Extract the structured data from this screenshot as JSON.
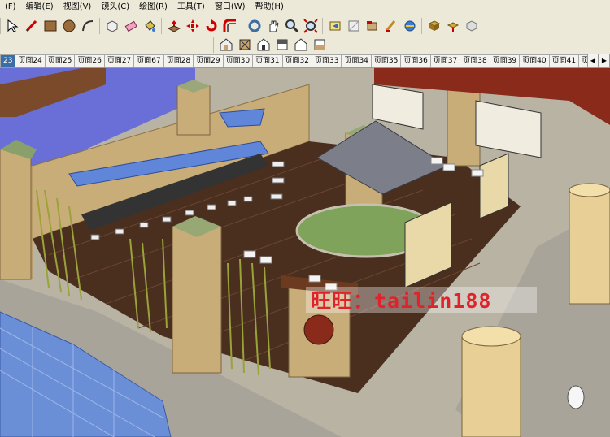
{
  "menubar": {
    "items": [
      "(F)",
      "编辑(E)",
      "视图(V)",
      "镜头(C)",
      "绘图(R)",
      "工具(T)",
      "窗口(W)",
      "帮助(H)"
    ]
  },
  "toolbar": {
    "icons": [
      "select-arrow-icon",
      "pencil-line-icon",
      "rectangle-icon",
      "circle-icon",
      "arc-icon",
      "make-component-icon",
      "eraser-icon",
      "paint-bucket-icon",
      "push-pull-icon",
      "move-icon",
      "rotate-icon",
      "offset-icon",
      "follow-me-icon",
      "orbit-icon",
      "pan-icon",
      "zoom-icon",
      "zoom-extents-icon",
      "previous-view-icon",
      "next-view-icon",
      "tape-measure-icon",
      "protractor-icon",
      "axes-icon",
      "text-icon",
      "dimension-icon",
      "section-icon",
      "3d-text-icon"
    ]
  },
  "toolbar2": {
    "icons": [
      "iso-view-icon",
      "top-view-icon",
      "front-view-icon",
      "right-view-icon",
      "back-view-icon",
      "left-view-icon"
    ]
  },
  "tabs": {
    "items": [
      "23",
      "页面24",
      "页面25",
      "页面26",
      "页面27",
      "页面67",
      "页面28",
      "页面29",
      "页面30",
      "页面31",
      "页面32",
      "页面33",
      "页面34",
      "页面35",
      "页面36",
      "页面37",
      "页面38",
      "页面39",
      "页面40",
      "页面41",
      "页面"
    ],
    "active_index": 0
  },
  "watermark": {
    "text": "旺旺：tailin188",
    "color": "#e0232a"
  },
  "colors": {
    "floor_wood": "#4a2f1f",
    "stone": "#c9ad78",
    "glass": "#6b8fd6",
    "roof": "#7c7f8a",
    "sky": "#6a6fd8"
  }
}
